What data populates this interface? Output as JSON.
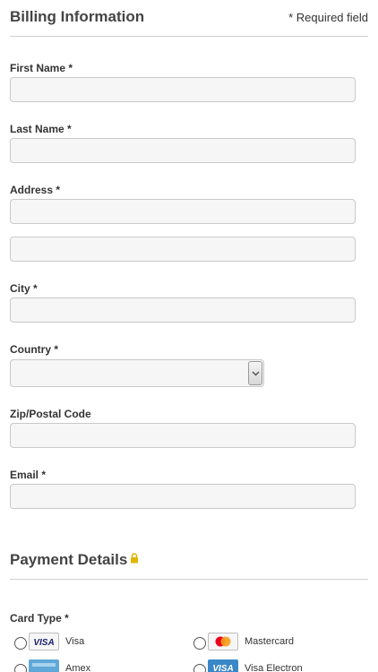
{
  "billing": {
    "title": "Billing Information",
    "required_note": "* Required field",
    "first_name": {
      "label": "First Name *",
      "value": ""
    },
    "last_name": {
      "label": "Last Name *",
      "value": ""
    },
    "address": {
      "label": "Address *",
      "line1": "",
      "line2": ""
    },
    "city": {
      "label": "City *",
      "value": ""
    },
    "country": {
      "label": "Country *",
      "value": ""
    },
    "zip": {
      "label": "Zip/Postal Code",
      "value": ""
    },
    "email": {
      "label": "Email *",
      "value": ""
    }
  },
  "payment": {
    "title": "Payment Details",
    "lock_icon": "lock-icon",
    "card_type_label": "Card Type *",
    "card_types": [
      {
        "name": "Visa",
        "icon": "visa-logo-icon",
        "selected": false
      },
      {
        "name": "Mastercard",
        "icon": "mastercard-logo-icon",
        "selected": false
      },
      {
        "name": "Amex",
        "icon": "amex-logo-icon",
        "selected": false
      },
      {
        "name": "Visa Electron",
        "icon": "visa-electron-logo-icon",
        "selected": false
      }
    ]
  },
  "colors": {
    "lock": "#e0b500",
    "visa_blue": "#1a1f71",
    "amex_blue": "#5fa8d8",
    "mastercard_red": "#eb001b",
    "mastercard_orange": "#f79e1b"
  }
}
